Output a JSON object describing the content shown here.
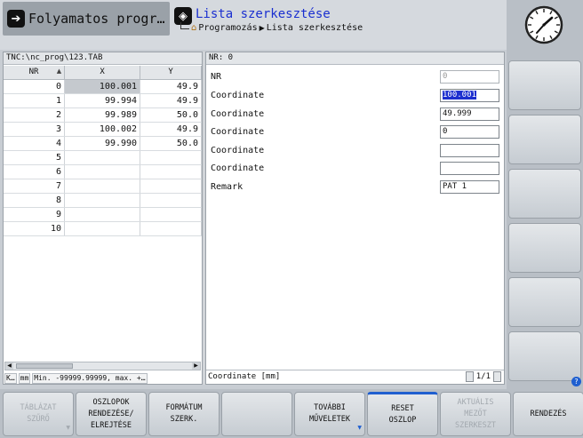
{
  "header": {
    "run_mode_label": "Folyamatos progr…",
    "run_mode_icon": "program-run-icon",
    "edit_mode_label": "Lista szerkesztése",
    "edit_mode_icon": "edit-mode-icon",
    "breadcrumb": {
      "home_icon": "home-icon",
      "item1": "Programozás",
      "separator": "▶",
      "item2": "Lista szerkesztése"
    }
  },
  "left_panel": {
    "file_path": "TNC:\\nc_prog\\123.TAB",
    "columns": [
      "NR",
      "X",
      "Y"
    ],
    "rows": [
      {
        "nr": "0",
        "x": "100.001",
        "y": "49.9"
      },
      {
        "nr": "1",
        "x": "99.994",
        "y": "49.9"
      },
      {
        "nr": "2",
        "x": "99.989",
        "y": "50.0"
      },
      {
        "nr": "3",
        "x": "100.002",
        "y": "49.9"
      },
      {
        "nr": "4",
        "x": "99.990",
        "y": "50.0"
      },
      {
        "nr": "5",
        "x": "",
        "y": ""
      },
      {
        "nr": "6",
        "x": "",
        "y": ""
      },
      {
        "nr": "7",
        "x": "",
        "y": ""
      },
      {
        "nr": "8",
        "x": "",
        "y": ""
      },
      {
        "nr": "9",
        "x": "",
        "y": ""
      },
      {
        "nr": "10",
        "x": "",
        "y": ""
      }
    ],
    "status": [
      "K…",
      "mm",
      "Min. -99999.99999, max. +…"
    ]
  },
  "right_panel": {
    "header": "NR: 0",
    "fields": [
      {
        "label": "NR",
        "value": "0"
      },
      {
        "label": "Coordinate",
        "value": "100.001"
      },
      {
        "label": "Coordinate",
        "value": "49.999"
      },
      {
        "label": "Coordinate",
        "value": "0"
      },
      {
        "label": "Coordinate",
        "value": ""
      },
      {
        "label": "Coordinate",
        "value": ""
      },
      {
        "label": "Remark",
        "value": "PAT 1"
      }
    ],
    "status_text": "Coordinate [mm]",
    "pager": "1/1"
  },
  "softkeys": [
    {
      "label": "TÁBLÁZAT\nSZŰRŐ",
      "enabled": false,
      "menu": true
    },
    {
      "label": "OSZLOPOK\nRENDEZÉSE/\nELREJTÉSE",
      "enabled": true,
      "menu": false
    },
    {
      "label": "FORMÁTUM\nSZERK.",
      "enabled": true,
      "menu": false
    },
    {
      "label": "",
      "enabled": true,
      "menu": false
    },
    {
      "label": "TOVÁBBI\nMŰVELETEK",
      "enabled": true,
      "menu": true
    },
    {
      "label": "RESET\nOSZLOP",
      "enabled": true,
      "menu": false
    },
    {
      "label": "AKTUÁLIS\nMEZŐT\nSZERKESZT",
      "enabled": false,
      "menu": false
    },
    {
      "label": "",
      "enabled": true,
      "menu": false
    },
    {
      "label": "RENDEZÉS",
      "enabled": true,
      "menu": false
    }
  ],
  "help_icon": "?",
  "colors": {
    "accent_blue": "#1d2fcf",
    "panel_bg": "#c8cdd3",
    "softkey_indicator": "#1f5fd0"
  }
}
